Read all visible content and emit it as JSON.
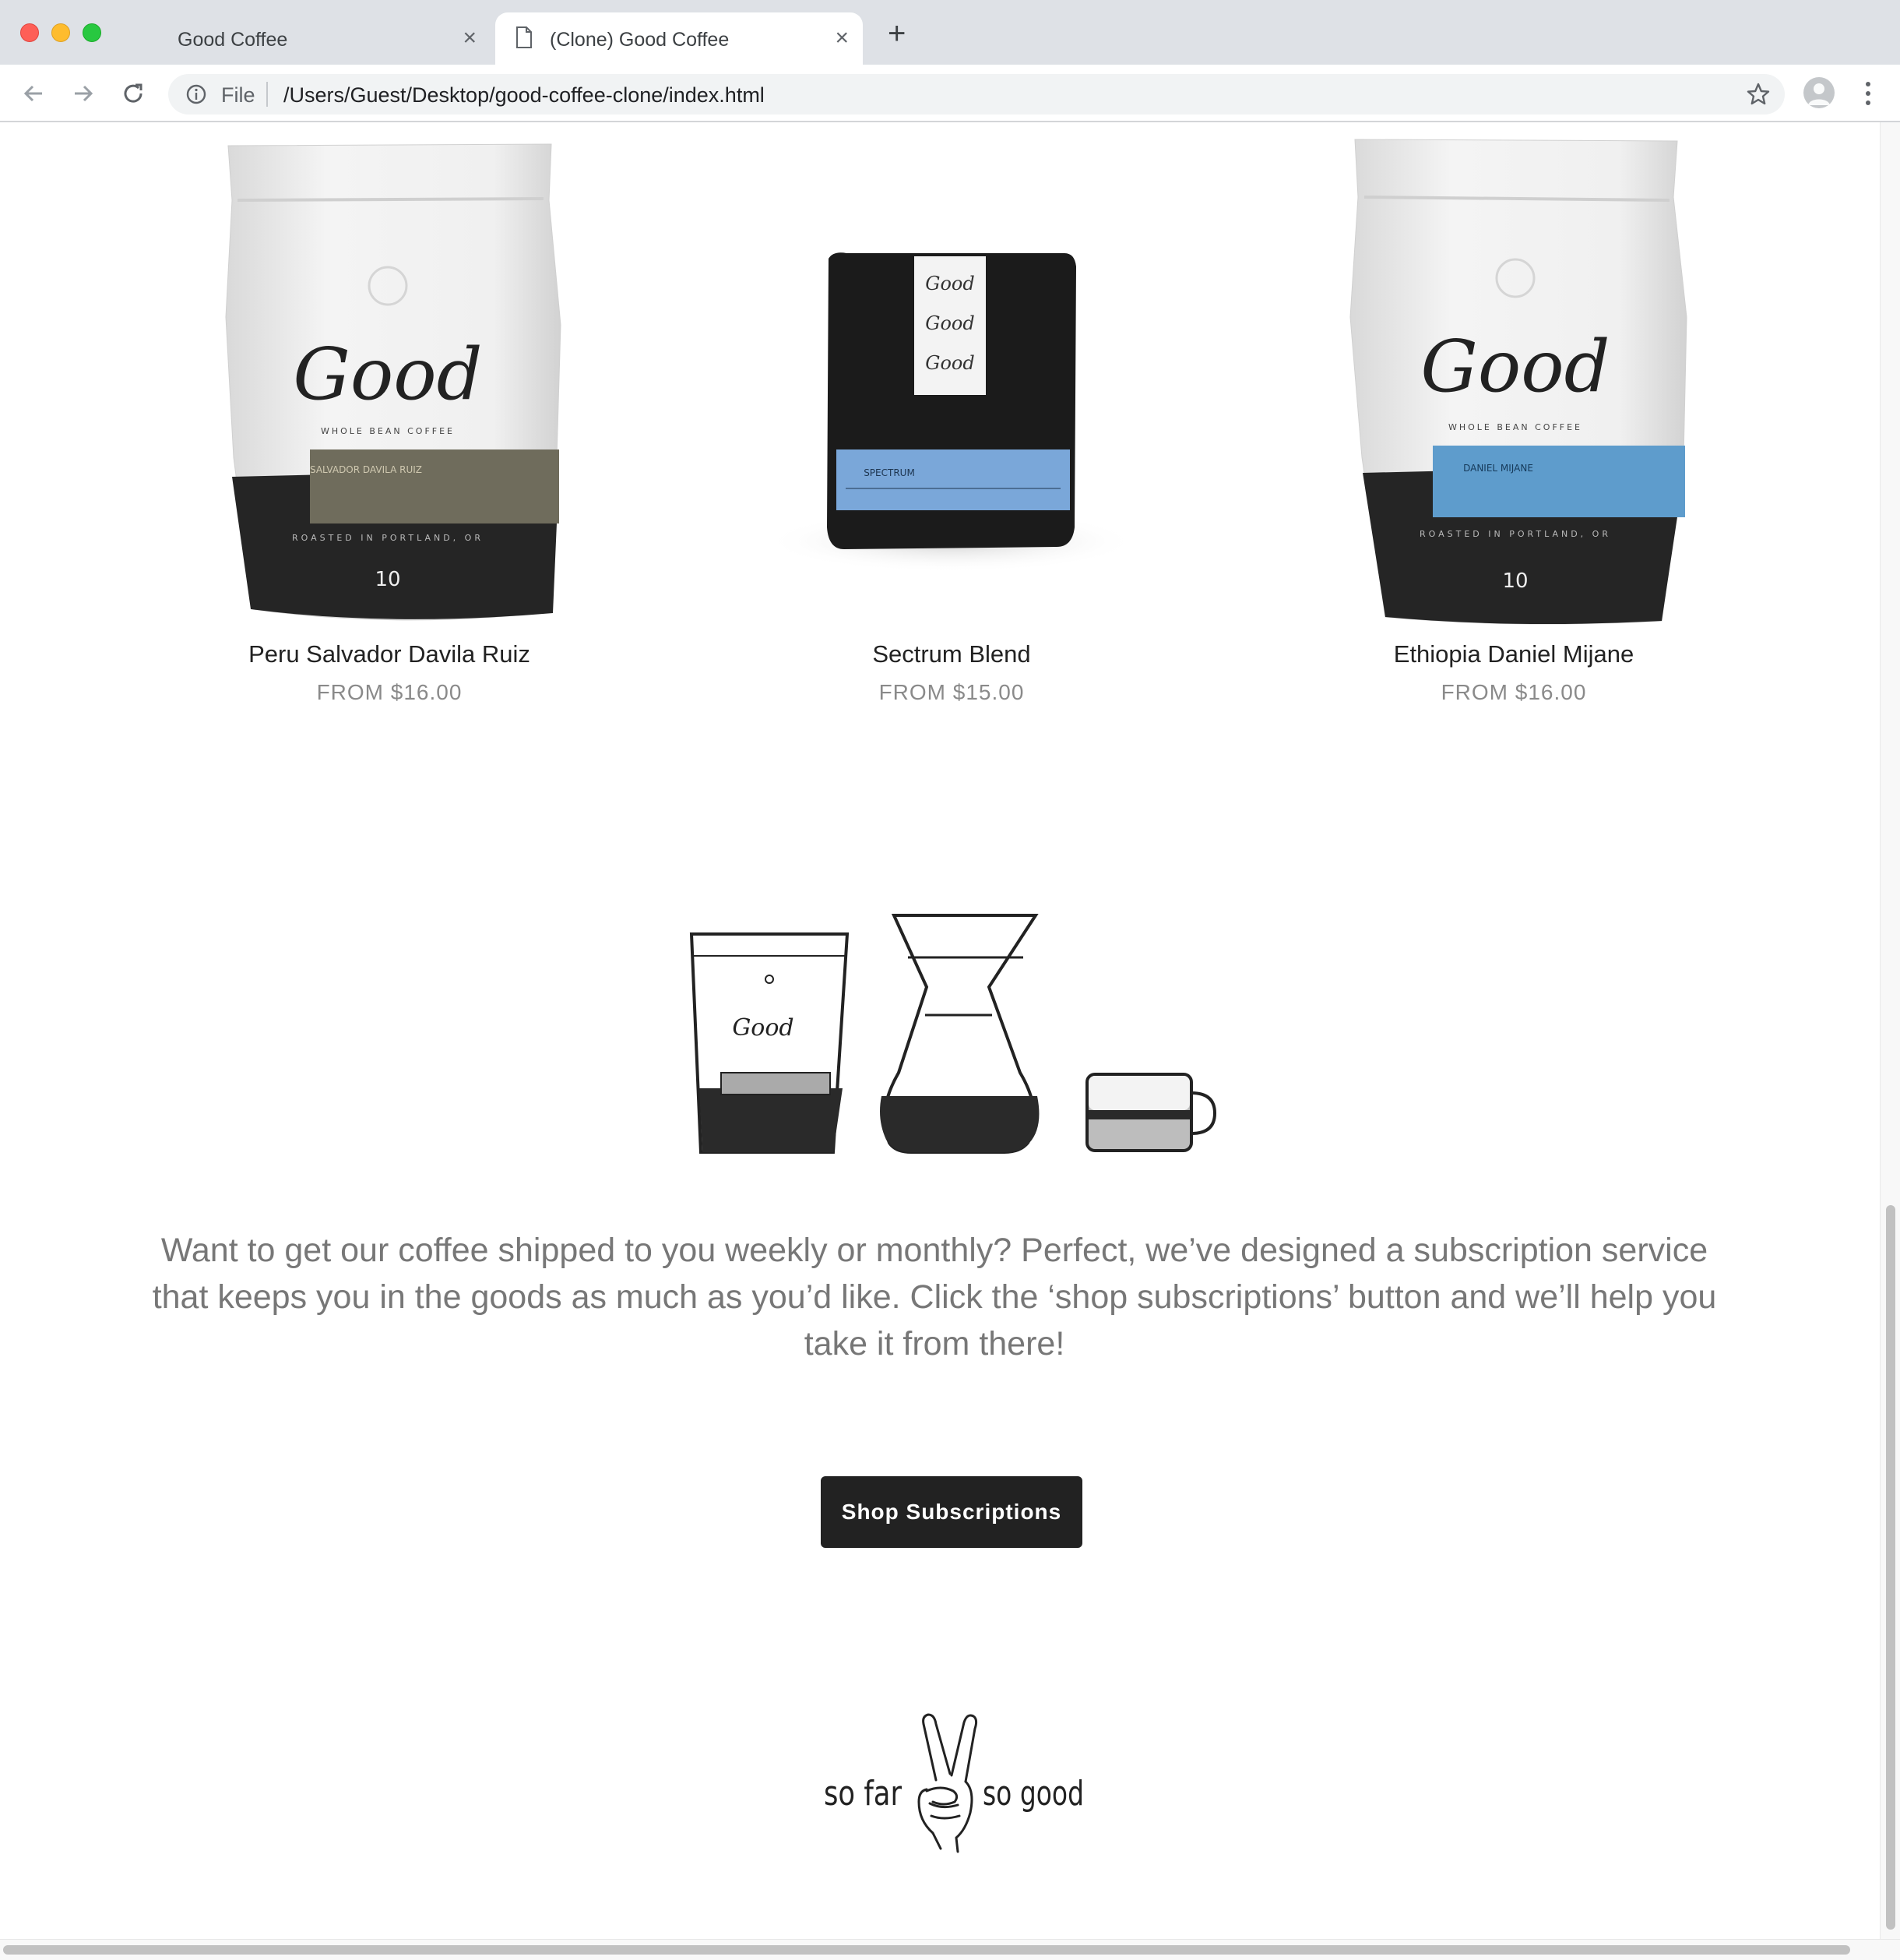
{
  "browser": {
    "tabs": [
      {
        "title": "Good Coffee",
        "active": false
      },
      {
        "title": "(Clone) Good Coffee",
        "active": true
      }
    ],
    "omnibox": {
      "scheme_label": "File",
      "url": "/Users/Guest/Desktop/good-coffee-clone/index.html"
    }
  },
  "products": [
    {
      "name": "Peru Salvador Davila Ruiz",
      "price": "FROM $16.00",
      "bag_label": "Good",
      "bag_sub": "WHOLE BEAN COFFEE",
      "bag_band": "SALVADOR DAVILA RUIZ",
      "bag_city": "ROASTED IN PORTLAND, OR",
      "bag_weight": "10",
      "band_color": "#6f6c5c"
    },
    {
      "name": "Sectrum Blend",
      "price": "FROM $15.00",
      "bag_label": "Good",
      "bag_band": "SPECTRUM",
      "band_color": "#7aa7d9"
    },
    {
      "name": "Ethiopia Daniel Mijane",
      "price": "FROM $16.00",
      "bag_label": "Good",
      "bag_sub": "WHOLE BEAN COFFEE",
      "bag_band": "DANIEL MIJANE",
      "bag_city": "ROASTED IN PORTLAND, OR",
      "bag_weight": "10",
      "band_color": "#5e9ccc"
    }
  ],
  "subscription": {
    "text": "Want to get our coffee shipped to you weekly or monthly? Perfect, we’ve designed a subscription service that keeps you in the goods as much as you’d like. Click the ‘shop subscriptions’ button and we’ll help you take it from there!",
    "button_label": "Shop Subscriptions",
    "illustration_bag_label": "Good"
  },
  "footer": {
    "left": "so far",
    "right": "so good"
  }
}
